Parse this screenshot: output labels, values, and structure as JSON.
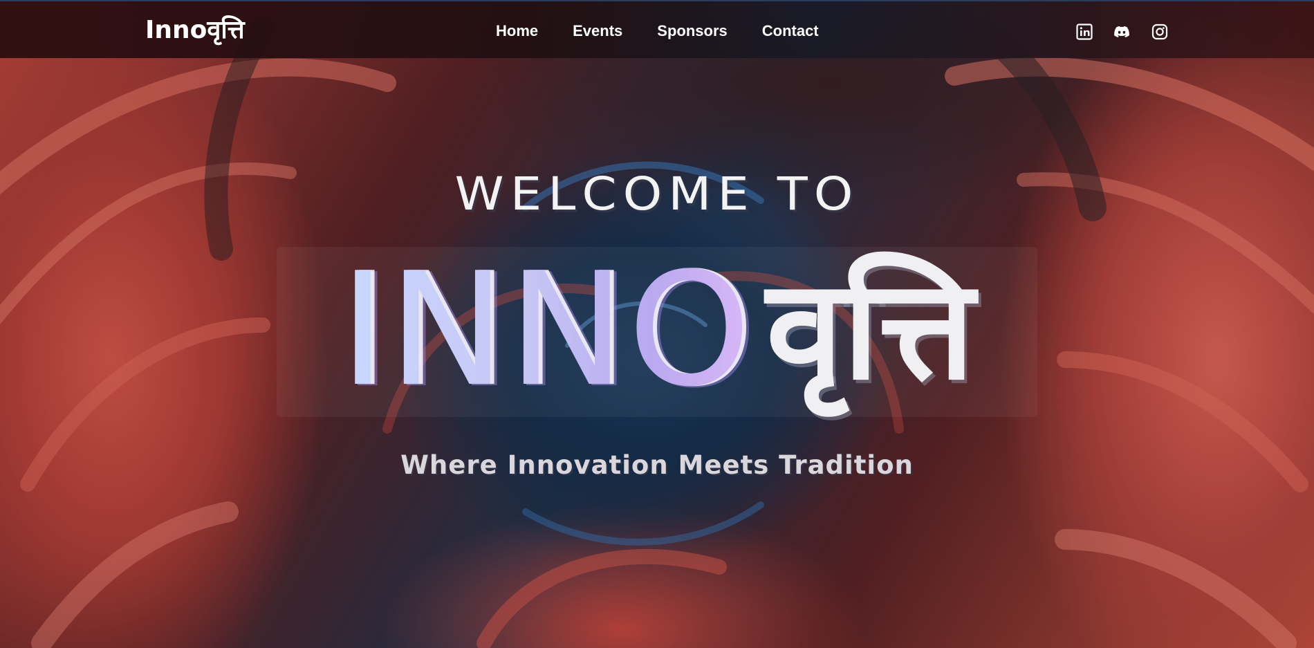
{
  "navbar": {
    "brand": "Innoवृत्ति",
    "links": [
      {
        "label": "Home"
      },
      {
        "label": "Events"
      },
      {
        "label": "Sponsors"
      },
      {
        "label": "Contact"
      }
    ],
    "social": [
      {
        "icon": "linkedin-icon"
      },
      {
        "icon": "discord-icon"
      },
      {
        "icon": "instagram-icon"
      }
    ]
  },
  "hero": {
    "welcome": "WELCOME TO",
    "title_latin": "INNO",
    "title_devanagari": "वृत्ति",
    "tagline": "Where Innovation Meets Tradition"
  },
  "colors": {
    "swirl_red": "#d9574c",
    "swirl_blue": "#1f3d63",
    "nav_background": "#2a0f11",
    "title_gradient_start": "#c9d8ff",
    "title_gradient_end": "#d9b8f7"
  }
}
